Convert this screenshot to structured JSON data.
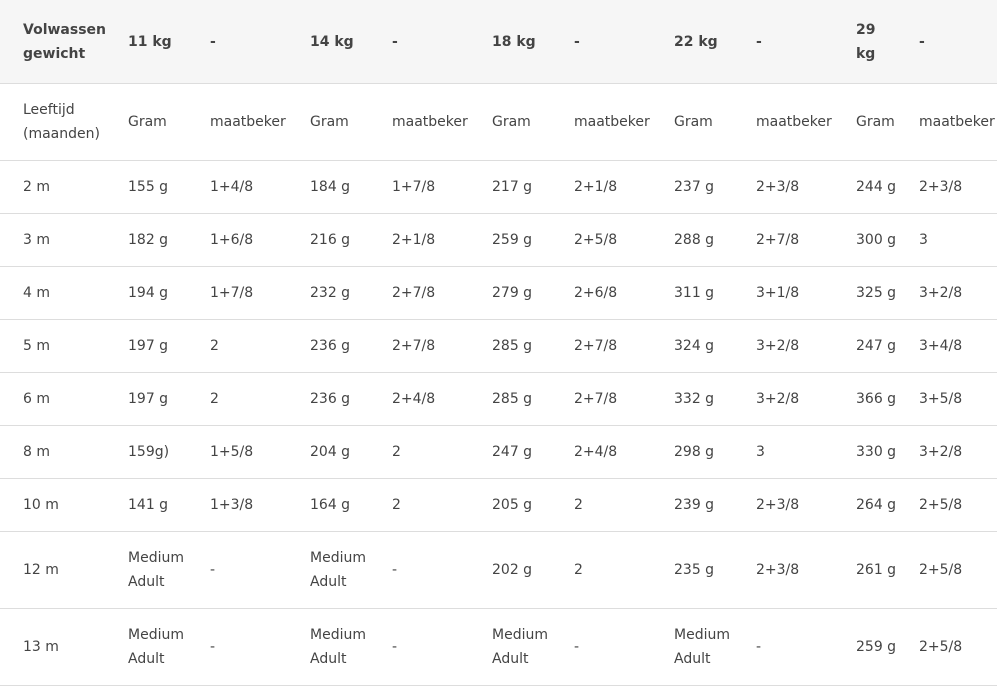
{
  "header": {
    "title_line1": "Volwassen",
    "title_line2": "gewicht",
    "weights": [
      {
        "label": "11 kg",
        "dash": "-"
      },
      {
        "label": "14 kg",
        "dash": "-"
      },
      {
        "label": "18 kg",
        "dash": "-"
      },
      {
        "label": "22 kg",
        "dash": "-"
      },
      {
        "label_line1": "29",
        "label_line2": "kg",
        "dash": "-"
      }
    ]
  },
  "subheader": {
    "age_line1": "Leeftijd",
    "age_line2": "(maanden)",
    "gram": "Gram",
    "cup": "maatbeker"
  },
  "rows": [
    {
      "age": "2 m",
      "cells": [
        "155 g",
        "1+4/8",
        "184 g",
        "1+7/8",
        "217 g",
        "2+1/8",
        "237 g",
        "2+3/8",
        "244 g",
        "2+3/8"
      ]
    },
    {
      "age": "3 m",
      "cells": [
        "182 g",
        "1+6/8",
        "216 g",
        "2+1/8",
        "259 g",
        "2+5/8",
        "288 g",
        "2+7/8",
        "300 g",
        "3"
      ]
    },
    {
      "age": "4 m",
      "cells": [
        "194 g",
        "1+7/8",
        "232 g",
        "2+7/8",
        "279 g",
        "2+6/8",
        "311 g",
        "3+1/8",
        "325 g",
        "3+2/8"
      ]
    },
    {
      "age": "5 m",
      "cells": [
        "197 g",
        "2",
        "236 g",
        "2+7/8",
        "285 g",
        "2+7/8",
        "324 g",
        "3+2/8",
        "247 g",
        "3+4/8"
      ]
    },
    {
      "age": "6 m",
      "cells": [
        "197 g",
        "2",
        "236 g",
        "2+4/8",
        "285 g",
        "2+7/8",
        "332 g",
        "3+2/8",
        "366 g",
        "3+5/8"
      ]
    },
    {
      "age": "8 m",
      "cells": [
        "159g)",
        "1+5/8",
        "204 g",
        "2",
        "247 g",
        "2+4/8",
        "298 g",
        "3",
        "330 g",
        "3+2/8"
      ]
    },
    {
      "age": "10 m",
      "cells": [
        "141 g",
        "1+3/8",
        "164 g",
        "2",
        "205 g",
        "2",
        "239 g",
        "2+3/8",
        "264 g",
        "2+5/8"
      ]
    },
    {
      "age": "12 m",
      "cells": [
        "Medium Adult",
        "-",
        "Medium Adult",
        "-",
        "202 g",
        "2",
        "235 g",
        "2+3/8",
        "261 g",
        "2+5/8"
      ]
    },
    {
      "age": "13 m",
      "cells": [
        "Medium Adult",
        "-",
        "Medium Adult",
        "-",
        "Medium Adult",
        "-",
        "Medium Adult",
        "-",
        "259 g",
        "2+5/8"
      ]
    }
  ]
}
